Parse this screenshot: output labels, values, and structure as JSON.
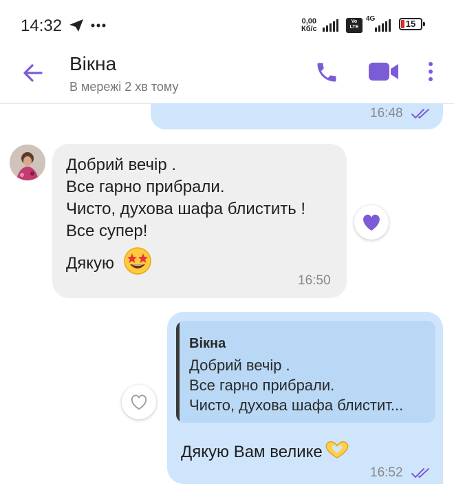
{
  "status_bar": {
    "time": "14:32",
    "net_speed_value": "0,00",
    "net_speed_unit": "Кб/с",
    "volte": "Vo LTE",
    "network_type": "4G",
    "battery": "15"
  },
  "header": {
    "contact_name": "Вікна",
    "status": "В мережі 2 хв тому"
  },
  "messages": [
    {
      "direction": "out",
      "time": "16:48",
      "read": true
    },
    {
      "direction": "in",
      "lines": [
        "Добрий вечір .",
        "Все гарно прибрали.",
        "Чисто, духова шафа блистить !",
        "Все супер!",
        "Дякую"
      ],
      "emoji": "🤩",
      "time": "16:50",
      "reaction": "heart-filled"
    },
    {
      "direction": "out",
      "quote": {
        "author": "Вікна",
        "lines": [
          "Добрий вечір .",
          "Все гарно прибрали.",
          "Чисто, духова шафа блистит..."
        ]
      },
      "text": "Дякую Вам велике",
      "emoji": "🫶",
      "time": "16:52",
      "read": true,
      "reaction": "heart-outline"
    }
  ],
  "colors": {
    "accent": "#7b5cd6",
    "outgoing_bubble": "#cfe5fb",
    "incoming_bubble": "#efefef",
    "quote_bg": "#b9d8f6"
  }
}
